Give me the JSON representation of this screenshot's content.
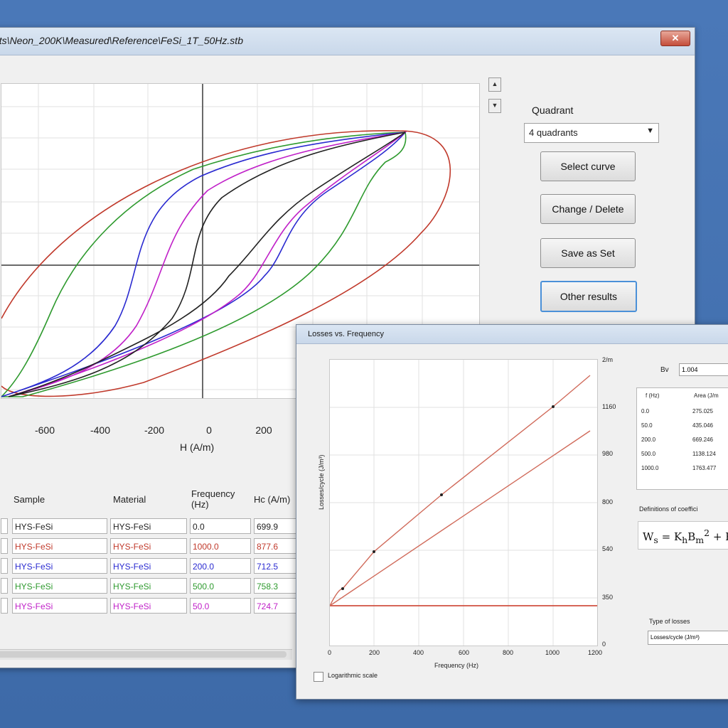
{
  "main_window": {
    "title": "nts\\Neon_200K\\Measured\\Reference\\FeSi_1T_50Hz.stb",
    "close_label": "✕",
    "x_ticks": [
      "-600",
      "-400",
      "-200",
      "0",
      "200"
    ],
    "x_label": "H (A/m)",
    "quadrant_label": "Quadrant",
    "quadrant_value": "4 quadrants",
    "buttons": {
      "select_curve": "Select curve",
      "change_delete": "Change / Delete",
      "save_as_set": "Save as Set",
      "other_results": "Other results"
    },
    "table": {
      "headers": [
        "Sample",
        "Material",
        "Frequency (Hz)",
        "Hc (A/m)"
      ],
      "rows": [
        {
          "sample": "HYS-FeSi",
          "material": "HYS-FeSi",
          "frequency": "0.0",
          "hc": "699.9",
          "color": "#222222"
        },
        {
          "sample": "HYS-FeSi",
          "material": "HYS-FeSi",
          "frequency": "1000.0",
          "hc": "877.6",
          "color": "#c0392b"
        },
        {
          "sample": "HYS-FeSi",
          "material": "HYS-FeSi",
          "frequency": "200.0",
          "hc": "712.5",
          "color": "#2a2ad0"
        },
        {
          "sample": "HYS-FeSi",
          "material": "HYS-FeSi",
          "frequency": "500.0",
          "hc": "758.3",
          "color": "#2e9a2e"
        },
        {
          "sample": "HYS-FeSi",
          "material": "HYS-FeSi",
          "frequency": "50.0",
          "hc": "724.7",
          "color": "#c020c8"
        }
      ]
    }
  },
  "losses_window": {
    "title": "Losses vs. Frequency",
    "x_label": "Frequency (Hz)",
    "y_label": "Losses/cycle (J/m³)",
    "x_ticks": [
      "0",
      "200",
      "400",
      "600",
      "800",
      "1000",
      "1200"
    ],
    "y_ticks_right": [
      "0",
      "350",
      "540",
      "800",
      "980",
      "1160",
      "2/m"
    ],
    "bv_label": "Bv",
    "bv_value": "1.004",
    "results_headers": [
      "f (Hz)",
      "Area (J/m"
    ],
    "results_rows": [
      [
        "0.0",
        "275.025"
      ],
      [
        "50.0",
        "435.046"
      ],
      [
        "200.0",
        "669.246"
      ],
      [
        "500.0",
        "1138.124"
      ],
      [
        "1000.0",
        "1763.477"
      ]
    ],
    "definitions_label": "Definitions of coeffici",
    "type_label": "Type of losses",
    "type_value": "Losses/cycle (J/m³)",
    "log_label": "Logarithmic scale"
  },
  "colors": {
    "desktop": "#3f6fb0",
    "red": "#c0392b",
    "black": "#222222",
    "blue": "#2a2ad0",
    "green": "#2e9a2e",
    "magenta": "#c020c8"
  }
}
